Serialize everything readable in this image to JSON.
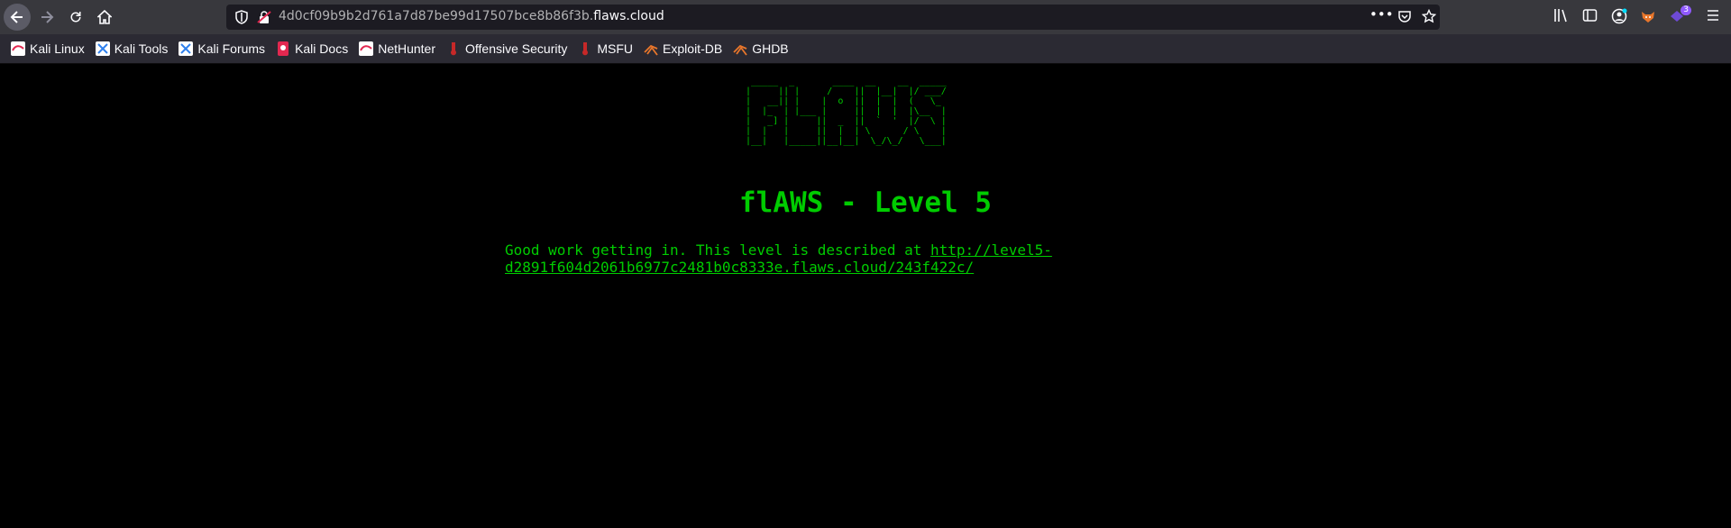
{
  "browser": {
    "url_prefix": "4d0cf09b9b2d761a7d87be99d17507bce8b86f3b.",
    "url_domain": "flaws.cloud",
    "extensions_badge": "3"
  },
  "bookmarks": [
    {
      "label": "Kali Linux",
      "icon": "kali-dragon-icon"
    },
    {
      "label": "Kali Tools",
      "icon": "kali-tools-icon"
    },
    {
      "label": "Kali Forums",
      "icon": "kali-forums-icon"
    },
    {
      "label": "Kali Docs",
      "icon": "kali-docs-icon"
    },
    {
      "label": "NetHunter",
      "icon": "nethunter-icon"
    },
    {
      "label": "Offensive Security",
      "icon": "offsec-icon"
    },
    {
      "label": "MSFU",
      "icon": "msfu-icon"
    },
    {
      "label": "Exploit-DB",
      "icon": "exploit-db-icon"
    },
    {
      "label": "GHDB",
      "icon": "ghdb-icon"
    }
  ],
  "page": {
    "ascii_logo": " _____  _       ____  __    __  _____\n|     || |     /    ||  |__|  |/ ___/\n|   __|| |    |  o  ||  |  |  (   \\_ \n|  |_  | |___ |     ||  |  |  |\\__  |\n|   _] |     ||  _  ||  `  '  |/  \\ |\n|  |   |     ||  |  | \\      / \\    |\n|__|   |_____||__|__|  \\_/\\_/   \\___|",
    "title": "flAWS - Level 5",
    "message": "Good work getting in. This level is described at ",
    "link_text": "http://level5-d2891f604d2061b6977c2481b0c8333e.flaws.cloud/243f422c/"
  },
  "colors": {
    "page_bg": "#000000",
    "text_green": "#00cc00",
    "toolbar_bg": "#38383d",
    "bookmarks_bg": "#2b2a33"
  }
}
